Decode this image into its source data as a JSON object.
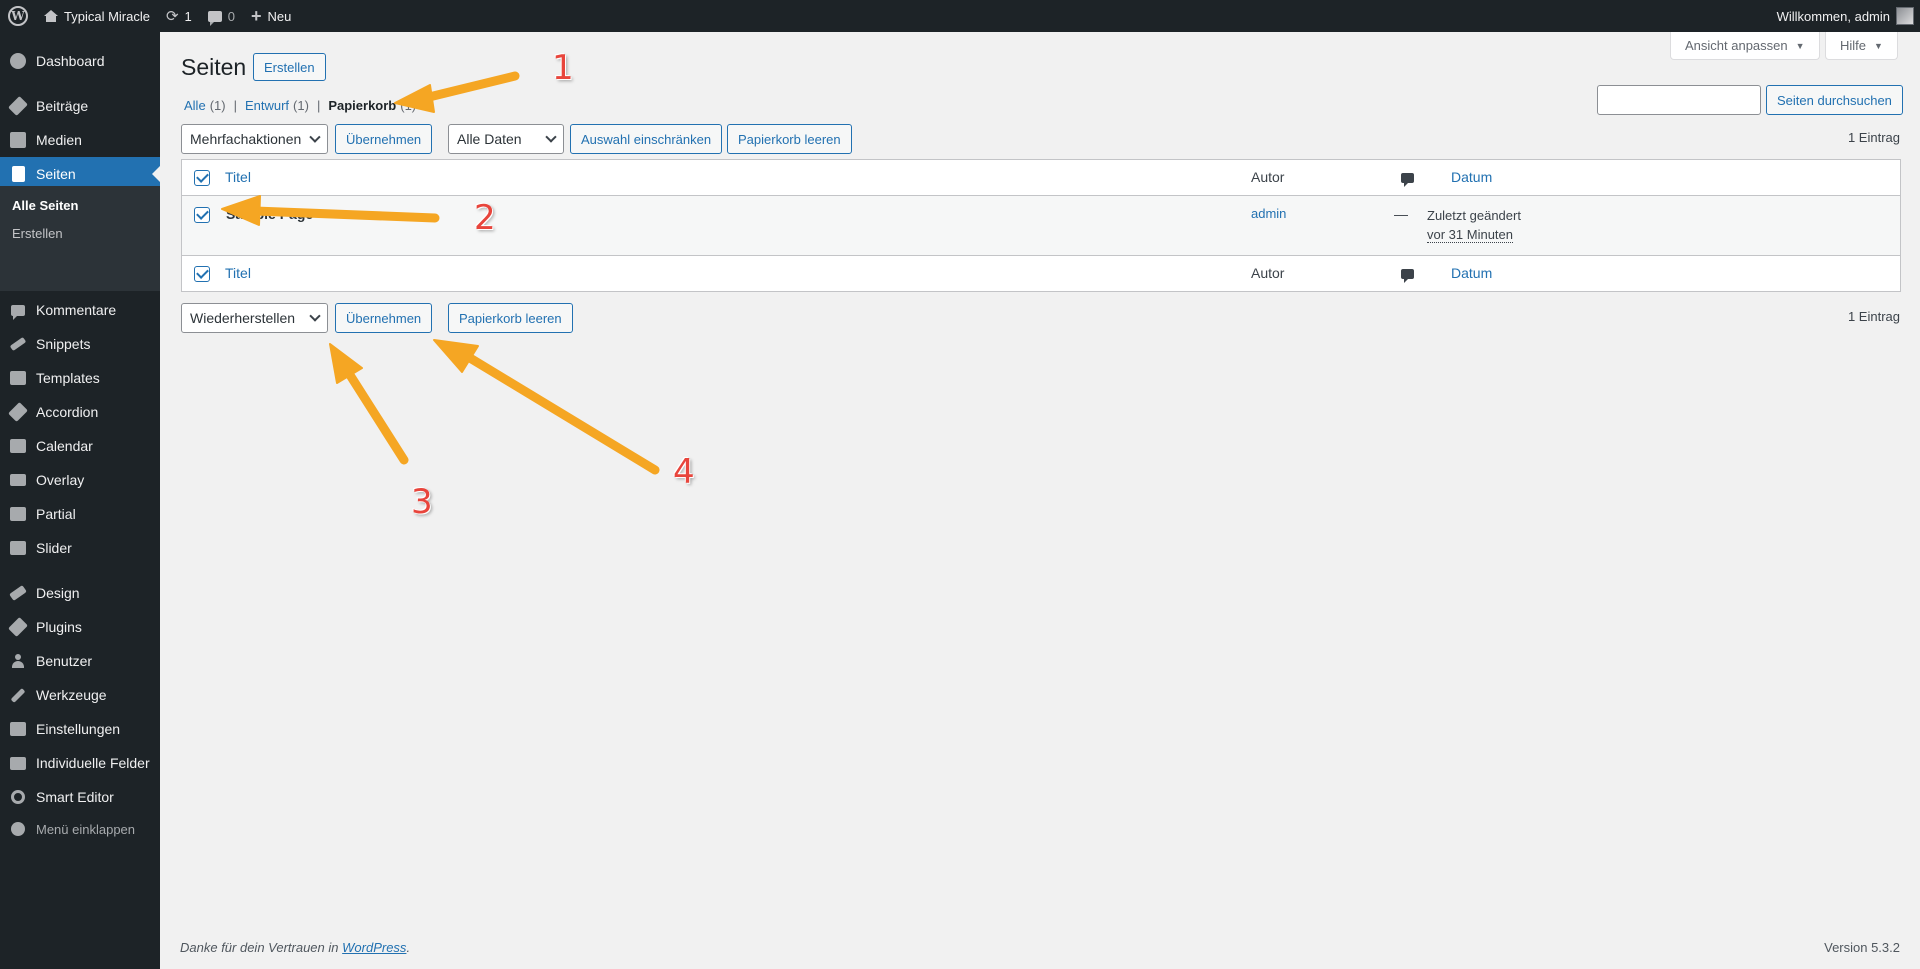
{
  "adminbar": {
    "site_name": "Typical Miracle",
    "updates_count": "1",
    "comments_count": "0",
    "new_label": "Neu",
    "welcome": "Willkommen, admin"
  },
  "sidebar": {
    "items": [
      {
        "label": "Dashboard",
        "icon": "dashboard-icon"
      },
      {
        "label": "Beiträge",
        "icon": "pin-icon"
      },
      {
        "label": "Medien",
        "icon": "media-icon"
      },
      {
        "label": "Seiten",
        "icon": "pages-icon"
      },
      {
        "label": "Kommentare",
        "icon": "comment-icon"
      },
      {
        "label": "Snippets",
        "icon": "snippet-icon"
      },
      {
        "label": "Templates",
        "icon": "template-icon"
      },
      {
        "label": "Accordion",
        "icon": "pin-icon"
      },
      {
        "label": "Calendar",
        "icon": "calendar-icon"
      },
      {
        "label": "Overlay",
        "icon": "overlay-icon"
      },
      {
        "label": "Partial",
        "icon": "grid-icon"
      },
      {
        "label": "Slider",
        "icon": "slider-icon"
      },
      {
        "label": "Design",
        "icon": "brush-icon"
      },
      {
        "label": "Plugins",
        "icon": "plugin-icon"
      },
      {
        "label": "Benutzer",
        "icon": "user-icon"
      },
      {
        "label": "Werkzeuge",
        "icon": "wrench-icon"
      },
      {
        "label": "Einstellungen",
        "icon": "settings-icon"
      },
      {
        "label": "Individuelle Felder",
        "icon": "fields-icon"
      },
      {
        "label": "Smart Editor",
        "icon": "gear-icon"
      }
    ],
    "submenu": [
      "Alle Seiten",
      "Erstellen"
    ],
    "collapse_label": "Menü einklappen"
  },
  "screen_meta": {
    "options_label": "Ansicht anpassen",
    "help_label": "Hilfe"
  },
  "page": {
    "title": "Seiten",
    "add_new": "Erstellen",
    "views": {
      "all": "Alle",
      "all_count": "(1)",
      "draft": "Entwurf",
      "draft_count": "(1)",
      "trash": "Papierkorb",
      "trash_count": "(1)",
      "separator": "|"
    },
    "search_button": "Seiten durchsuchen",
    "top_nav": {
      "bulk_select": "Mehrfachaktionen",
      "apply": "Übernehmen",
      "date_select": "Alle Daten",
      "filter": "Auswahl einschränken",
      "empty_trash": "Papierkorb leeren",
      "count": "1 Eintrag"
    },
    "bottom_nav": {
      "bulk_select": "Wiederherstellen",
      "apply": "Übernehmen",
      "empty_trash": "Papierkorb leeren",
      "count": "1 Eintrag"
    },
    "table": {
      "col_title": "Titel",
      "col_author": "Autor",
      "col_date": "Datum",
      "rows": [
        {
          "title": "Sample Page",
          "author": "admin",
          "comments": "—",
          "status": "Zuletzt geändert",
          "time": "vor 31 Minuten"
        }
      ]
    }
  },
  "footer": {
    "thanks_prefix": "Danke für dein Vertrauen in",
    "wp_link": "WordPress",
    "thanks_suffix": ".",
    "version": "Version 5.3.2"
  },
  "annotations": {
    "color": "#f5a623",
    "labels": [
      "1",
      "2",
      "3",
      "4"
    ]
  }
}
